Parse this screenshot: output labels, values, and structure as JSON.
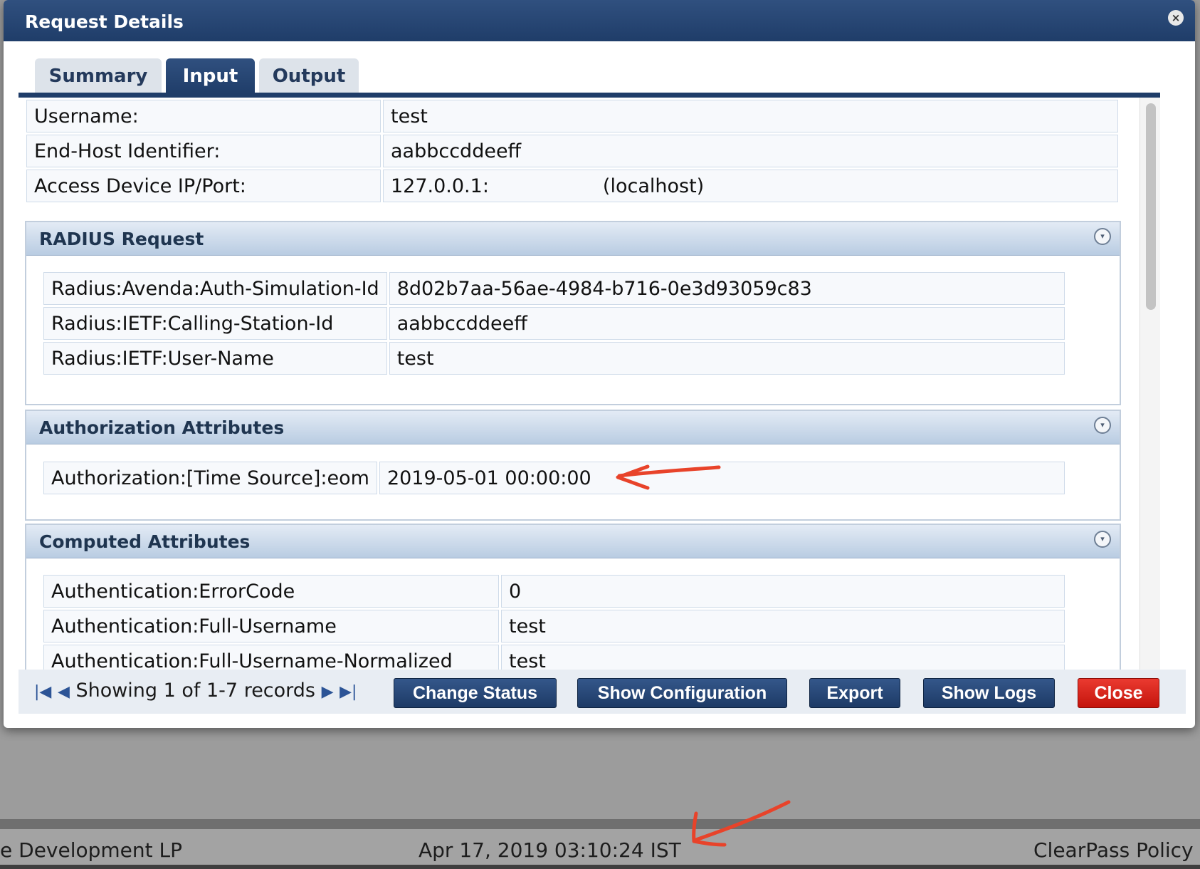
{
  "modal": {
    "title": "Request Details",
    "close_glyph": "×",
    "tabs": [
      {
        "label": "Summary",
        "active": false
      },
      {
        "label": "Input",
        "active": true
      },
      {
        "label": "Output",
        "active": false
      }
    ]
  },
  "input": {
    "rows": [
      {
        "label": "Username:",
        "value": "test",
        "extra": ""
      },
      {
        "label": "End-Host Identifier:",
        "value": "aabbccddeeff",
        "extra": ""
      },
      {
        "label": "Access Device IP/Port:",
        "value": "127.0.0.1:",
        "extra": "(localhost)"
      }
    ]
  },
  "sections": {
    "radius": {
      "title": "RADIUS Request",
      "rows": [
        {
          "key": "Radius:Avenda:Auth-Simulation-Id",
          "value": "8d02b7aa-56ae-4984-b716-0e3d93059c83"
        },
        {
          "key": "Radius:IETF:Calling-Station-Id",
          "value": "aabbccddeeff"
        },
        {
          "key": "Radius:IETF:User-Name",
          "value": "test"
        }
      ]
    },
    "authorization": {
      "title": "Authorization Attributes",
      "rows": [
        {
          "key": "Authorization:[Time Source]:eom",
          "value": "2019-05-01 00:00:00"
        }
      ]
    },
    "computed": {
      "title": "Computed Attributes",
      "rows": [
        {
          "key": "Authentication:ErrorCode",
          "value": "0"
        },
        {
          "key": "Authentication:Full-Username",
          "value": "test"
        },
        {
          "key": "Authentication:Full-Username-Normalized",
          "value": "test"
        }
      ]
    }
  },
  "pager": {
    "text": "Showing 1 of 1-7 records",
    "first_glyph": "|◀",
    "prev_glyph": "◀",
    "next_glyph": "▶",
    "last_glyph": "▶|"
  },
  "buttons": {
    "change_status": "Change Status",
    "show_configuration": "Show Configuration",
    "export": "Export",
    "show_logs": "Show Logs",
    "close": "Close"
  },
  "background_footer": {
    "left": "e Development LP",
    "center": "Apr 17, 2019 03:10:24 IST",
    "right": "ClearPass Policy M"
  },
  "colors": {
    "header_blue": "#1f3d69",
    "close_red": "#d4231a",
    "annotation_red": "#e8432a"
  },
  "icons": {
    "modal_close": "close-circle-icon",
    "section_toggle": "collapse-circle-icon",
    "annotation": "red-arrow-annotation"
  }
}
